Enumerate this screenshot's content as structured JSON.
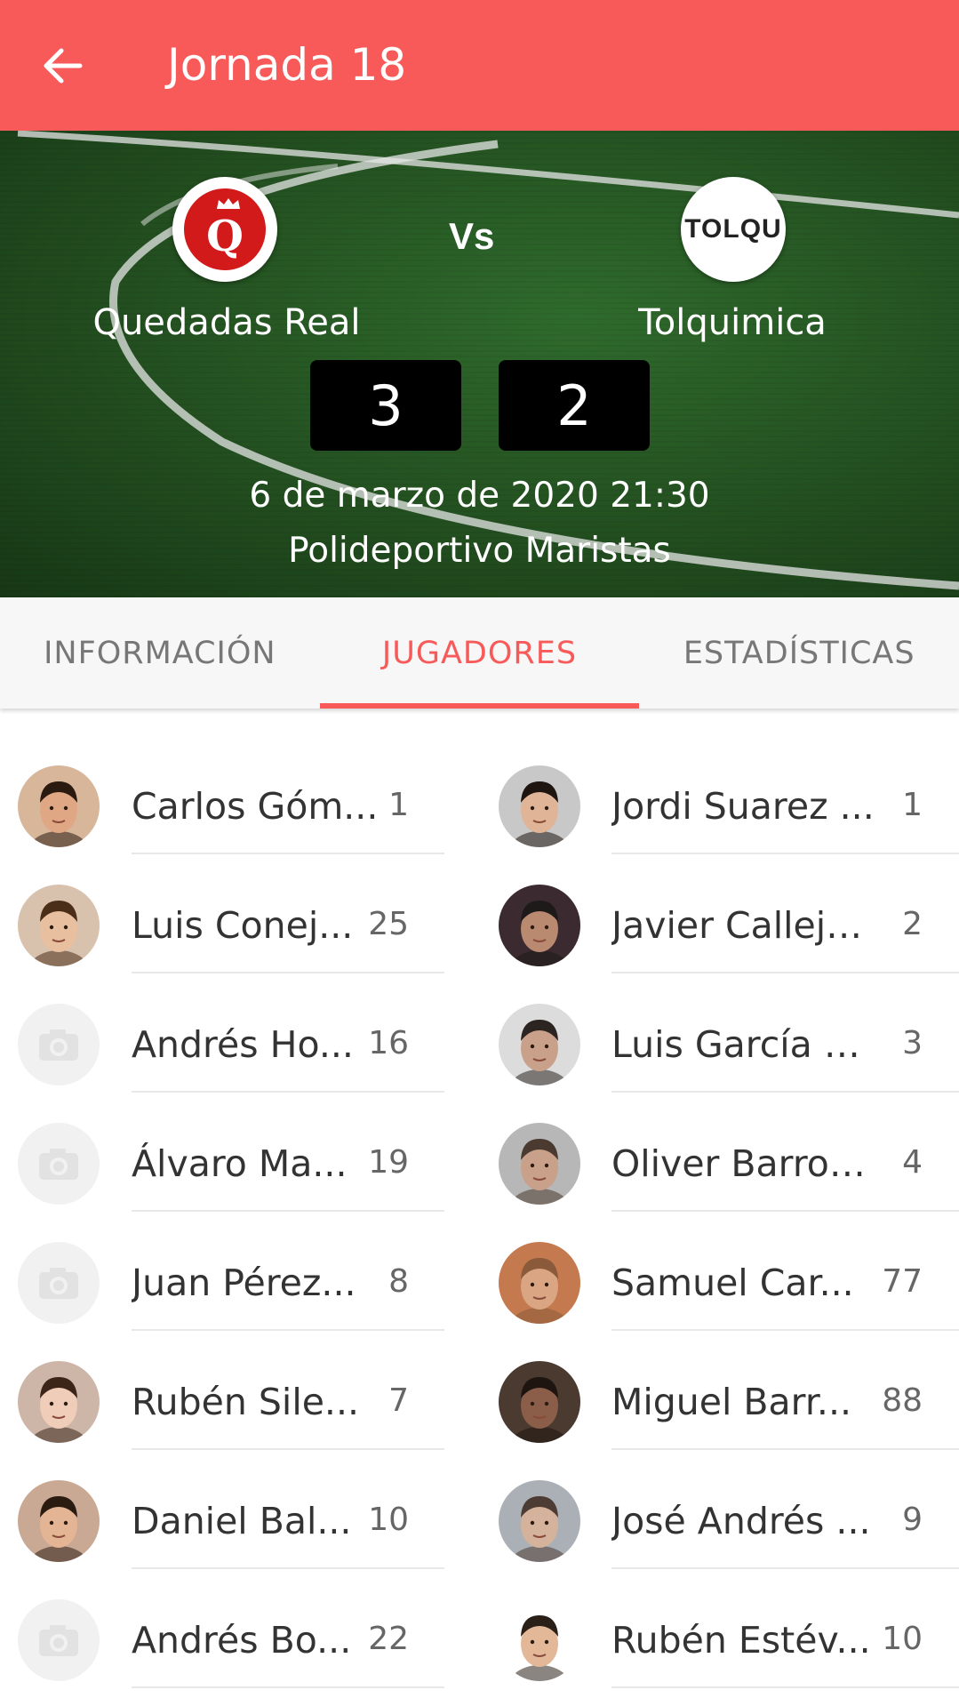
{
  "appbar": {
    "title": "Jornada 18"
  },
  "match": {
    "home_team": "Quedadas Real",
    "away_team": "Tolquimica",
    "home_logo_text": "Q",
    "away_logo_text": "TOLQU",
    "vs": "Vs",
    "home_score": "3",
    "away_score": "2",
    "date": "6 de marzo de 2020 21:30",
    "venue": "Polideportivo Maristas"
  },
  "tabs": [
    {
      "label": "INFORMACIÓN"
    },
    {
      "label": "JUGADORES"
    },
    {
      "label": "ESTADÍSTICAS"
    }
  ],
  "home_players": [
    {
      "name": "Carlos Góm...",
      "number": "1"
    },
    {
      "name": "Luis Conej...",
      "number": "25"
    },
    {
      "name": "Andrés Ho...",
      "number": "16"
    },
    {
      "name": "Álvaro Ma...",
      "number": "19"
    },
    {
      "name": "Juan Pérez...",
      "number": "8"
    },
    {
      "name": "Rubén Sile...",
      "number": "7"
    },
    {
      "name": "Daniel Bal...",
      "number": "10"
    },
    {
      "name": "Andrés Bo...",
      "number": "22"
    }
  ],
  "away_players": [
    {
      "name": "Jordi Suarez ...",
      "number": "1"
    },
    {
      "name": "Javier Calleja...",
      "number": "2"
    },
    {
      "name": "Luis García M...",
      "number": "3"
    },
    {
      "name": "Oliver Barros...",
      "number": "4"
    },
    {
      "name": "Samuel Car...",
      "number": "77"
    },
    {
      "name": "Miguel Barr...",
      "number": "88"
    },
    {
      "name": "José Andrés ...",
      "number": "9"
    },
    {
      "name": "Rubén Estév...",
      "number": "10"
    }
  ],
  "colors": {
    "accent": "#f85a5a",
    "tab_inactive": "#777777",
    "field_green": "#2f6b2c"
  },
  "icons": {
    "back": "arrow-left-icon",
    "placeholder_avatar": "camera-icon"
  }
}
